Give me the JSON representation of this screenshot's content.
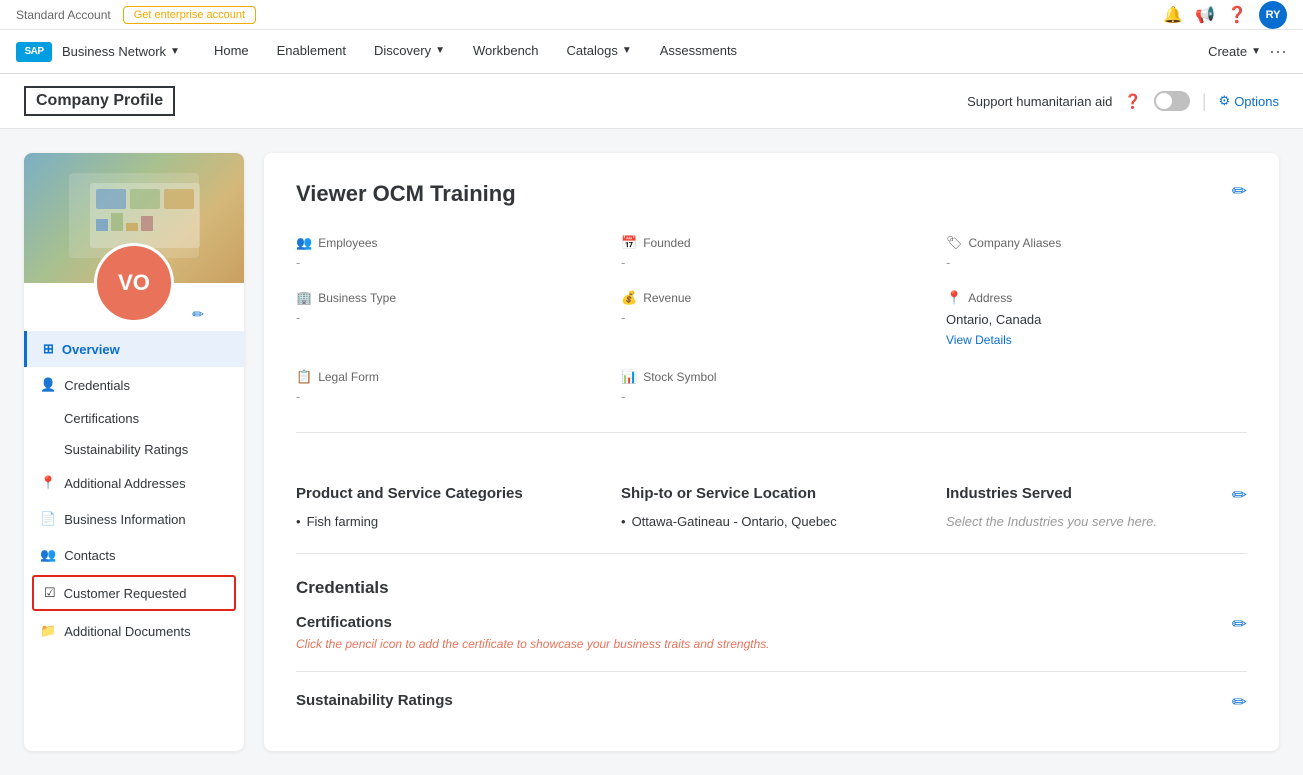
{
  "topBanner": {
    "brandLabel": "Business Network",
    "accountType": "Standard Account",
    "enterpriseBtn": "Get enterprise account",
    "userInitials": "RY"
  },
  "navbar": {
    "logo": "SAP",
    "brandName": "Business Network",
    "navItems": [
      {
        "label": "Home",
        "hasDropdown": false
      },
      {
        "label": "Enablement",
        "hasDropdown": false
      },
      {
        "label": "Discovery",
        "hasDropdown": true
      },
      {
        "label": "Workbench",
        "hasDropdown": false
      },
      {
        "label": "Catalogs",
        "hasDropdown": true
      },
      {
        "label": "Assessments",
        "hasDropdown": false
      }
    ],
    "createLabel": "Create",
    "moreLabel": "···"
  },
  "pageHeader": {
    "title": "Company Profile",
    "supportLabel": "Support humanitarian aid",
    "optionsLabel": "Options"
  },
  "sidebar": {
    "avatarInitials": "VO",
    "navItems": [
      {
        "label": "Overview",
        "icon": "grid",
        "active": true,
        "sub": []
      },
      {
        "label": "Credentials",
        "icon": "user",
        "active": false,
        "sub": [
          {
            "label": "Certifications"
          },
          {
            "label": "Sustainability Ratings"
          }
        ]
      },
      {
        "label": "Additional Addresses",
        "icon": "location",
        "active": false,
        "sub": []
      },
      {
        "label": "Business Information",
        "icon": "document",
        "active": false,
        "sub": []
      },
      {
        "label": "Contacts",
        "icon": "contacts",
        "active": false,
        "sub": []
      },
      {
        "label": "Customer Requested",
        "icon": "checklist",
        "active": false,
        "highlighted": true,
        "sub": []
      },
      {
        "label": "Additional Documents",
        "icon": "file",
        "active": false,
        "sub": []
      }
    ]
  },
  "companyInfo": {
    "companyName": "Viewer OCM Training",
    "fields": [
      {
        "label": "Employees",
        "value": "-",
        "icon": "people"
      },
      {
        "label": "Founded",
        "value": "-",
        "icon": "calendar"
      },
      {
        "label": "Company Aliases",
        "value": "-",
        "icon": "tag"
      },
      {
        "label": "Business Type",
        "value": "-",
        "icon": "building"
      },
      {
        "label": "Revenue",
        "value": "-",
        "icon": "money"
      },
      {
        "label": "Address",
        "value": "Ontario, Canada",
        "extra": "View Details",
        "icon": "location"
      },
      {
        "label": "Legal Form",
        "value": "-",
        "icon": "form"
      },
      {
        "label": "Stock Symbol",
        "value": "-",
        "icon": "chart"
      }
    ]
  },
  "productSection": {
    "title": "Product and Service Categories",
    "items": [
      "Fish farming"
    ]
  },
  "shipSection": {
    "title": "Ship-to or Service Location",
    "items": [
      "Ottawa-Gatineau - Ontario, Quebec"
    ]
  },
  "industriesSection": {
    "title": "Industries Served",
    "placeholder": "Select the Industries you serve here."
  },
  "credentials": {
    "sectionTitle": "Credentials",
    "certifications": {
      "title": "Certifications",
      "hint": "Click the pencil icon to add the certificate to showcase your business traits and strengths."
    },
    "sustainability": {
      "title": "Sustainability Ratings"
    }
  }
}
